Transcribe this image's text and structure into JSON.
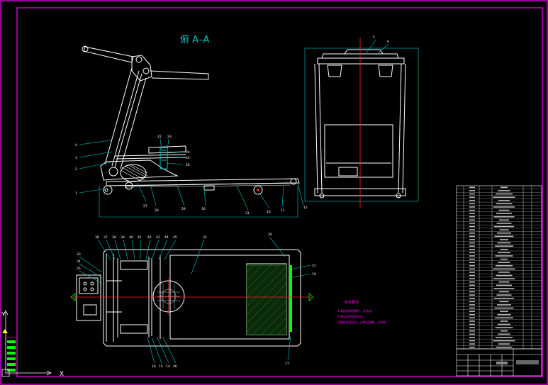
{
  "section_title": "俯 A–A",
  "callouts_front": [
    "4",
    "3",
    "2",
    "1",
    "22",
    "23",
    "24",
    "25",
    "26",
    "27",
    "28",
    "29",
    "30",
    "31",
    "10",
    "11",
    "12",
    "13",
    "14"
  ],
  "callouts_top": [
    "33",
    "34",
    "35",
    "36",
    "37",
    "38",
    "39",
    "40",
    "41",
    "42",
    "43",
    "44",
    "45",
    "32",
    "20",
    "21",
    "19",
    "17",
    "16",
    "15",
    "14",
    "46",
    "47",
    "48",
    "49"
  ],
  "callouts_right": [
    "5",
    "6",
    "7",
    "8",
    "9"
  ],
  "tech_title": "技术要求",
  "tech_notes": [
    "1.装配前清洗零件，去毛刺。",
    "2.各运动件转动灵活。",
    "3.跑带张紧适当，运转无跑偏、无异响。"
  ],
  "ucs": {
    "x_label": "X",
    "y_label": "Y"
  },
  "colors": {
    "background": "#000000",
    "frame": "#ff00ff",
    "lines": "#ffffff",
    "centerline": "#ff2020",
    "dims": "#00c8c8",
    "hatch": "#22aa22",
    "notes": "#ff00ff",
    "accent_green": "#00ff00",
    "accent_yellow": "#ffff00"
  }
}
